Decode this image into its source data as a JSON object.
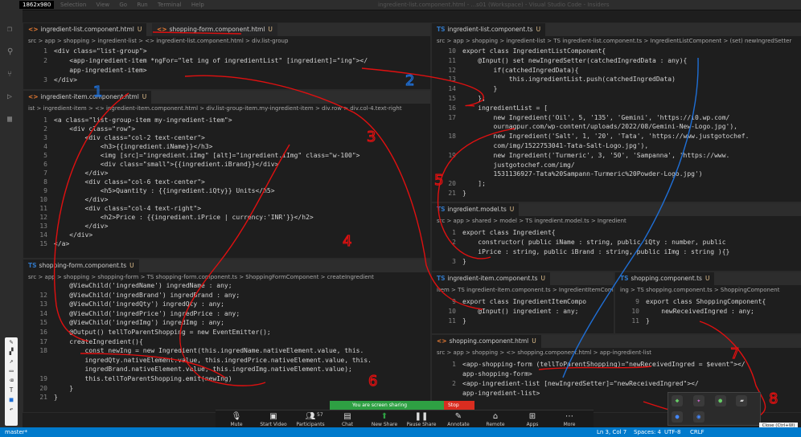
{
  "title_bar": {
    "resolution": "1862x980",
    "menu": [
      "Selection",
      "View",
      "Go",
      "Run",
      "Terminal",
      "Help"
    ],
    "window_title": "ingredient-list.component.html - ...s01 (Workspace) - Visual Studio Code - Insiders"
  },
  "pane_list_html": {
    "tabs": [
      {
        "label": "ingredient-list.component.html",
        "marker": "U"
      },
      {
        "label": "shopping-form.component.html",
        "marker": "U"
      }
    ],
    "breadcrumb": "src > app > shopping > ingredient-list > <> ingredient-list.component.html > div.list-group",
    "lines": [
      {
        "n": "1",
        "code": "<div class=\"list-group\">"
      },
      {
        "n": "2",
        "code": "    <app-ingredient-item *ngFor=\"let ing of ingredientList\" [ingredient]=\"ing\"></"
      },
      {
        "n": "",
        "code": "    app-ingredient-item>"
      },
      {
        "n": "3",
        "code": "</div>"
      }
    ]
  },
  "pane_item_html": {
    "tab": {
      "label": "ingredient-item.component.html",
      "marker": "U"
    },
    "breadcrumb": "ist > ingredient-item > <> ingredient-item.component.html > div.list-group-item.my-ingredient-item > div.row > div.col-4.text-right",
    "lines": [
      {
        "n": "1",
        "code": "<a class=\"list-group-item my-ingredient-item\">"
      },
      {
        "n": "2",
        "code": "    <div class=\"row\">"
      },
      {
        "n": "3",
        "code": "        <div class=\"col-2 text-center\">"
      },
      {
        "n": "4",
        "code": "            <h3>{{ingredient.iName}}</h3>"
      },
      {
        "n": "5",
        "code": "            <img [src]=\"ingredient.iImg\" [alt]=\"ingredient.iImg\" class=\"w-100\">"
      },
      {
        "n": "6",
        "code": "            <div class=\"small\">{{ingredient.iBrand}}</div>"
      },
      {
        "n": "7",
        "code": "        </div>"
      },
      {
        "n": "8",
        "code": "        <div class=\"col-6 text-center\">"
      },
      {
        "n": "9",
        "code": "            <h5>Quantity : {{ingredient.iQty}} Units</h5>"
      },
      {
        "n": "10",
        "code": "        </div>"
      },
      {
        "n": "11",
        "code": "        <div class=\"col-4 text-right\">"
      },
      {
        "n": "12",
        "code": "            <h2>Price : {{ingredient.iPrice | currency:'INR'}}</h2>"
      },
      {
        "n": "13",
        "code": "        </div>"
      },
      {
        "n": "14",
        "code": "    </div>"
      },
      {
        "n": "15",
        "code": "</a>"
      }
    ]
  },
  "pane_form_ts": {
    "tab": {
      "label": "shopping-form.component.ts",
      "marker": "U"
    },
    "breadcrumb": "src > app > shopping > shopping-form > TS shopping-form.component.ts > ShoppingFormComponent > createIngredient",
    "lines": [
      {
        "n": "",
        "code": "    @ViewChild('ingredName') ingredName : any;"
      },
      {
        "n": "12",
        "code": "    @ViewChild('ingredBrand') ingredBrand : any;"
      },
      {
        "n": "13",
        "code": "    @ViewChild('ingredQty') ingredQty : any;"
      },
      {
        "n": "14",
        "code": "    @ViewChild('ingredPrice') ingredPrice : any;"
      },
      {
        "n": "15",
        "code": "    @ViewChild('ingredImg') ingredImg : any;"
      },
      {
        "n": "16",
        "code": "    @Output() tellToParentShopping = new EventEmitter();"
      },
      {
        "n": "17",
        "code": "    createIngredient(){"
      },
      {
        "n": "18",
        "code": "        const newIng = new Ingredient(this.ingredName.nativeElement.value, this."
      },
      {
        "n": "",
        "code": "        ingredQty.nativeElement.value, this.ingredPrice.nativeElement.value, this."
      },
      {
        "n": "",
        "code": "        ingredBrand.nativeElement.value, this.ingredImg.nativeElement.value);"
      },
      {
        "n": "19",
        "code": "        this.tellToParentShopping.emit(newIng)"
      },
      {
        "n": "20",
        "code": "    }"
      },
      {
        "n": "21",
        "code": "}"
      }
    ]
  },
  "pane_list_ts": {
    "tab": {
      "label": "ingredient-list.component.ts",
      "marker": "U"
    },
    "breadcrumb": "src > app > shopping > ingredient-list > TS ingredient-list.component.ts > IngredientListComponent > (set) newIngredSetter",
    "lines": [
      {
        "n": "10",
        "code": "export class IngredientListComponent{"
      },
      {
        "n": "11",
        "code": "    @Input() set newIngredSetter(catchedIngredData : any){"
      },
      {
        "n": "12",
        "code": "        if(catchedIngredData){"
      },
      {
        "n": "13",
        "code": "            this.ingredientList.push(catchedIngredData)"
      },
      {
        "n": "14",
        "code": "        }"
      },
      {
        "n": "15",
        "code": "    };"
      },
      {
        "n": "16",
        "code": "    ingredientList = ["
      },
      {
        "n": "17",
        "code": "        new Ingredient('Oil', 5, '135', 'Gemini', 'https://i0.wp.com/"
      },
      {
        "n": "",
        "code": "        ournagpur.com/wp-content/uploads/2022/08/Gemini-New-Logo.jpg'),"
      },
      {
        "n": "18",
        "code": "        new Ingredient('Salt', 1, '20', 'Tata', 'https://www.justgotochef."
      },
      {
        "n": "",
        "code": "        com/img/1522753041-Tata-Salt-Logo.jpg'),"
      },
      {
        "n": "19",
        "code": "        new Ingredient('Turmeric', 3, '50', 'Sampanna', 'https://www."
      },
      {
        "n": "",
        "code": "        justgotochef.com/img/"
      },
      {
        "n": "",
        "code": "        1531136927-Tata%20Sampann-Turmeric%20Powder-Logo.jpg')"
      },
      {
        "n": "20",
        "code": "    ];"
      },
      {
        "n": "21",
        "code": "}"
      }
    ]
  },
  "pane_model_ts": {
    "tab": {
      "label": "ingredient.model.ts",
      "marker": "U"
    },
    "breadcrumb": "src > app > shared > model > TS ingredient.model.ts > Ingredient",
    "lines": [
      {
        "n": "1",
        "code": "export class Ingredient{"
      },
      {
        "n": "2",
        "code": "    constructor( public iName : string, public iQty : number, public"
      },
      {
        "n": "",
        "code": "    iPrice : string, public iBrand : string, public iImg : string ){}"
      },
      {
        "n": "3",
        "code": "}"
      }
    ]
  },
  "pane_item_ts": {
    "tab": {
      "label": "ingredient-item.component.ts",
      "marker": "U"
    },
    "breadcrumb": "item > TS ingredient-item.component.ts > IngredientItemComponent",
    "lines": [
      {
        "n": "9",
        "code": "export class IngredientItemCompo"
      },
      {
        "n": "10",
        "code": "    @Input() ingredient : any;"
      },
      {
        "n": "11",
        "code": "}"
      }
    ]
  },
  "pane_shopping_ts": {
    "tab": {
      "label": "shopping.component.ts",
      "marker": "U"
    },
    "breadcrumb": "ing > TS shopping.component.ts > ShoppingComponent",
    "lines": [
      {
        "n": "9",
        "code": "export class ShoppingComponent{"
      },
      {
        "n": "10",
        "code": "    newReceivedIngred : any;"
      },
      {
        "n": "11",
        "code": "}"
      }
    ]
  },
  "pane_shopping_html": {
    "tab": {
      "label": "shopping.component.html",
      "marker": "U"
    },
    "breadcrumb": "src > app > shopping > <> shopping.component.html > app-ingredient-list",
    "lines": [
      {
        "n": "1",
        "code": "<app-shopping-form (tellToParentShopping)=\"newReceivedIngred = $event\"></"
      },
      {
        "n": "",
        "code": "app-shopping-form>"
      },
      {
        "n": "2",
        "code": "<app-ingredient-list [newIngredSetter]=\"newReceivedIngred\"></"
      },
      {
        "n": "",
        "code": "app-ingredient-list>"
      }
    ]
  },
  "screen_share": {
    "label": "You are screen sharing",
    "stop": "Stop Share"
  },
  "zoom_toolbar": [
    {
      "label": "Mute",
      "icon": "microphone-icon"
    },
    {
      "label": "Start Video",
      "icon": "camera-icon"
    },
    {
      "label": "Participants",
      "icon": "people-icon",
      "count": "57"
    },
    {
      "label": "Chat",
      "icon": "chat-icon"
    },
    {
      "label": "New Share",
      "icon": "share-icon"
    },
    {
      "label": "Pause Share",
      "icon": "pause-icon"
    },
    {
      "label": "Annotate",
      "icon": "pen-icon"
    },
    {
      "label": "Remote Control",
      "icon": "mouse-icon"
    },
    {
      "label": "Apps",
      "icon": "apps-icon"
    },
    {
      "label": "More",
      "icon": "more-icon"
    }
  ],
  "status_bar": {
    "branch": "master*",
    "position": "Ln 3, Col 7",
    "spaces": "Spaces: 4",
    "encoding": "UTF-8",
    "eol": "CRLF"
  },
  "tooltip": "Close (Ctrl+W)",
  "annotations": [
    "1",
    "2",
    "3",
    "4",
    "5",
    "6",
    "7",
    "8"
  ],
  "colors": {
    "accent": "#007acc",
    "ink": "#e01010",
    "ink2": "#1f6fd6",
    "share": "#2ea043"
  }
}
